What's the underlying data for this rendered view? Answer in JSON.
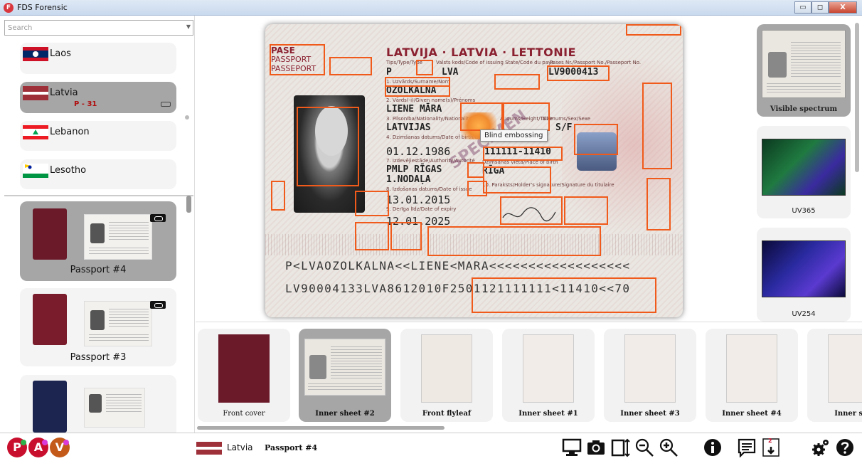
{
  "window": {
    "title": "FDS Forensic",
    "logo": "F",
    "min_label": "▭",
    "max_label": "◻",
    "close_label": "X"
  },
  "sidebar": {
    "search_placeholder": "Search",
    "countries": [
      {
        "name": "Laos",
        "selected": false
      },
      {
        "name": "Latvia",
        "selected": true,
        "count": "P - 31"
      },
      {
        "name": "Lebanon",
        "selected": false
      },
      {
        "name": "Lesotho",
        "selected": false
      }
    ],
    "documents": [
      {
        "label": "Passport #4",
        "selected": true
      },
      {
        "label": "Passport #3",
        "selected": false
      },
      {
        "label": "",
        "selected": false
      }
    ]
  },
  "passport": {
    "type_word": "PASE",
    "type_en": "PASSPORT",
    "type_fr": "PASSEPORT",
    "country_header": "LATVIJA · LATVIA · LETTONIE",
    "field_type_label": "Tips/Type/Type",
    "field_code_label": "Valsts kods/Code of issuing State/Code du pays",
    "field_passport_label": "Pases Nr./Passport No./Passeport No.",
    "type_value": "P",
    "code_value": "LVA",
    "passport_no": "LV9000413",
    "surname_label": "1. Uzvārds/Surname/Nom",
    "surname": "OZOLKALNA",
    "given_label": "2. Vārds(-i)/Given name(s)/Prénoms",
    "given": "LIENE MĀRA",
    "nationality_label": "3. Pilsonība/Nationality/Nationalité",
    "nationality": "LATVIJAS",
    "sex_label": "Dzimums/Sex/Sexe",
    "sex": "S/F",
    "height_label": "Augums/Height/Taille",
    "birth_label": "4. Dzimšanas datums/Date of birth/Date de naissance",
    "birth": "01.12.1986",
    "personal_code": "111111-11410",
    "authority_label": "7. Izdevējiestāde/Authority/Autorité",
    "authority": "PMLP RĪGAS",
    "authority2": "1.NODAĻA",
    "place_label": "Dzimšanas vieta/Place of birth",
    "place": "RĪGA",
    "issue_label": "8. Izdošanas datums/Date of issue",
    "issue": "13.01.2015",
    "expiry_label": "9. Derīga līdz/Date of expiry",
    "expiry": "12.01.2025",
    "signature_label": "10. Paraksts/Holder's signature/Signature du titulaire",
    "specimen": "SPECIMEN",
    "mrz1": "P<LVAOZOLKALNA<<LIENE<MARA<<<<<<<<<<<<<<<<<<",
    "mrz2": "LV90004133LVA8612010F2501121111111<11410<<70"
  },
  "tooltip": "Blind embossing",
  "spectrum": [
    {
      "label": "Visible spectrum",
      "selected": true
    },
    {
      "label": "UV365",
      "selected": false
    },
    {
      "label": "UV254",
      "selected": false
    }
  ],
  "pages": [
    {
      "label": "Front cover",
      "selected": false,
      "bold": false
    },
    {
      "label": "Inner sheet #2",
      "selected": true,
      "bold": true
    },
    {
      "label": "Front flyleaf",
      "selected": false,
      "bold": true
    },
    {
      "label": "Inner sheet #1",
      "selected": false,
      "bold": true
    },
    {
      "label": "Inner sheet #3",
      "selected": false,
      "bold": true
    },
    {
      "label": "Inner sheet #4",
      "selected": false,
      "bold": true
    },
    {
      "label": "Inner she",
      "selected": false,
      "bold": true
    }
  ],
  "status": {
    "country": "Latvia",
    "document": "Passport #4",
    "p_label": "P",
    "a_label": "A",
    "v_label": "V",
    "save_badge": "2",
    "colors": {
      "p": "#c8102e",
      "a": "#c8102e",
      "v": "#c45a1a",
      "p_dot": "#2db34a",
      "a_dot": "#d93ad9",
      "v_dot": "#d93ad9",
      "accent_box": "#f05a1a"
    }
  }
}
